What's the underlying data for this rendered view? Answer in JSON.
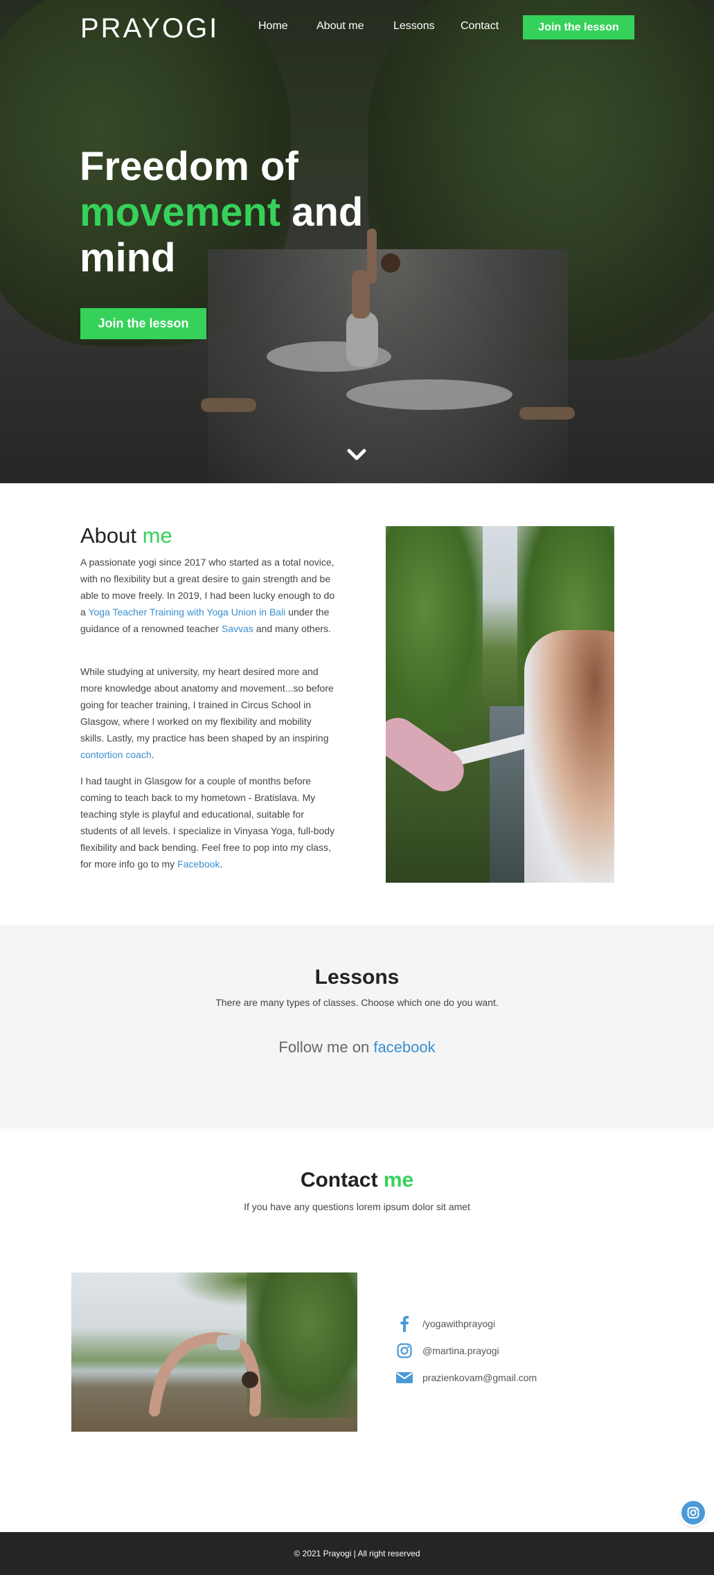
{
  "brand": {
    "logo": "PRAYOGI",
    "accent": "#36d15a",
    "link_color": "#3a8fd0"
  },
  "nav": {
    "items": [
      {
        "label": "Home"
      },
      {
        "label": "About me"
      },
      {
        "label": "Lessons"
      },
      {
        "label": "Contact"
      }
    ],
    "cta": "Join the lesson"
  },
  "hero": {
    "title_line1": "Freedom of",
    "title_green": "movement",
    "title_line2_rest": " and",
    "title_line3": "mind",
    "cta": "Join the lesson",
    "scroll_icon": "chevron-down-icon"
  },
  "about": {
    "title": "About ",
    "title_green": "me",
    "p1_a": "A passionate yogi since 2017 who started as a total novice, with no flexibility but a great desire to gain strength and be able to move freely. In 2019, I had been lucky enough to do a ",
    "p1_link1": "Yoga Teacher Training with Yoga Union in Bali",
    "p1_b": " under the guidance of a renowned teacher ",
    "p1_link2": "Savvas",
    "p1_c": " and many others.",
    "p2_a": "While studying at university, my heart desired more and more knowledge about anatomy and movement...so before going for teacher training, I trained in Circus School in Glasgow, where I worked on my flexibility and mobility skills. Lastly, my practice has been shaped by an inspiring ",
    "p2_link": "contortion coach",
    "p2_b": ".",
    "p3_a": "I had taught in Glasgow for a couple of months before coming to teach back to my hometown - Bratislava. My teaching style is playful and educational, suitable for students of all levels. I specialize in Vinyasa Yoga, full-body flexibility and back bending. Feel free to pop into my class, for more info go to my ",
    "p3_link": "Facebook",
    "p3_b": "."
  },
  "lessons": {
    "title": "Lessons",
    "subtitle": "There are many types of classes. Choose which one do you want.",
    "follow_text": "Follow me on ",
    "follow_link": "facebook"
  },
  "contact": {
    "title": "Contact ",
    "title_green": "me",
    "subtitle": "If you have any questions lorem ipsum dolor sit amet",
    "items": [
      {
        "icon": "facebook-icon",
        "text": "/yogawithprayogi"
      },
      {
        "icon": "instagram-icon",
        "text": "@martina.prayogi"
      },
      {
        "icon": "mail-icon",
        "text": "prazienkovam@gmail.com"
      }
    ]
  },
  "floating": [
    {
      "icon": "instagram-icon"
    },
    {
      "icon": "facebook-icon"
    }
  ],
  "footer": {
    "text": "© 2021 Prayogi | All right reserved"
  }
}
